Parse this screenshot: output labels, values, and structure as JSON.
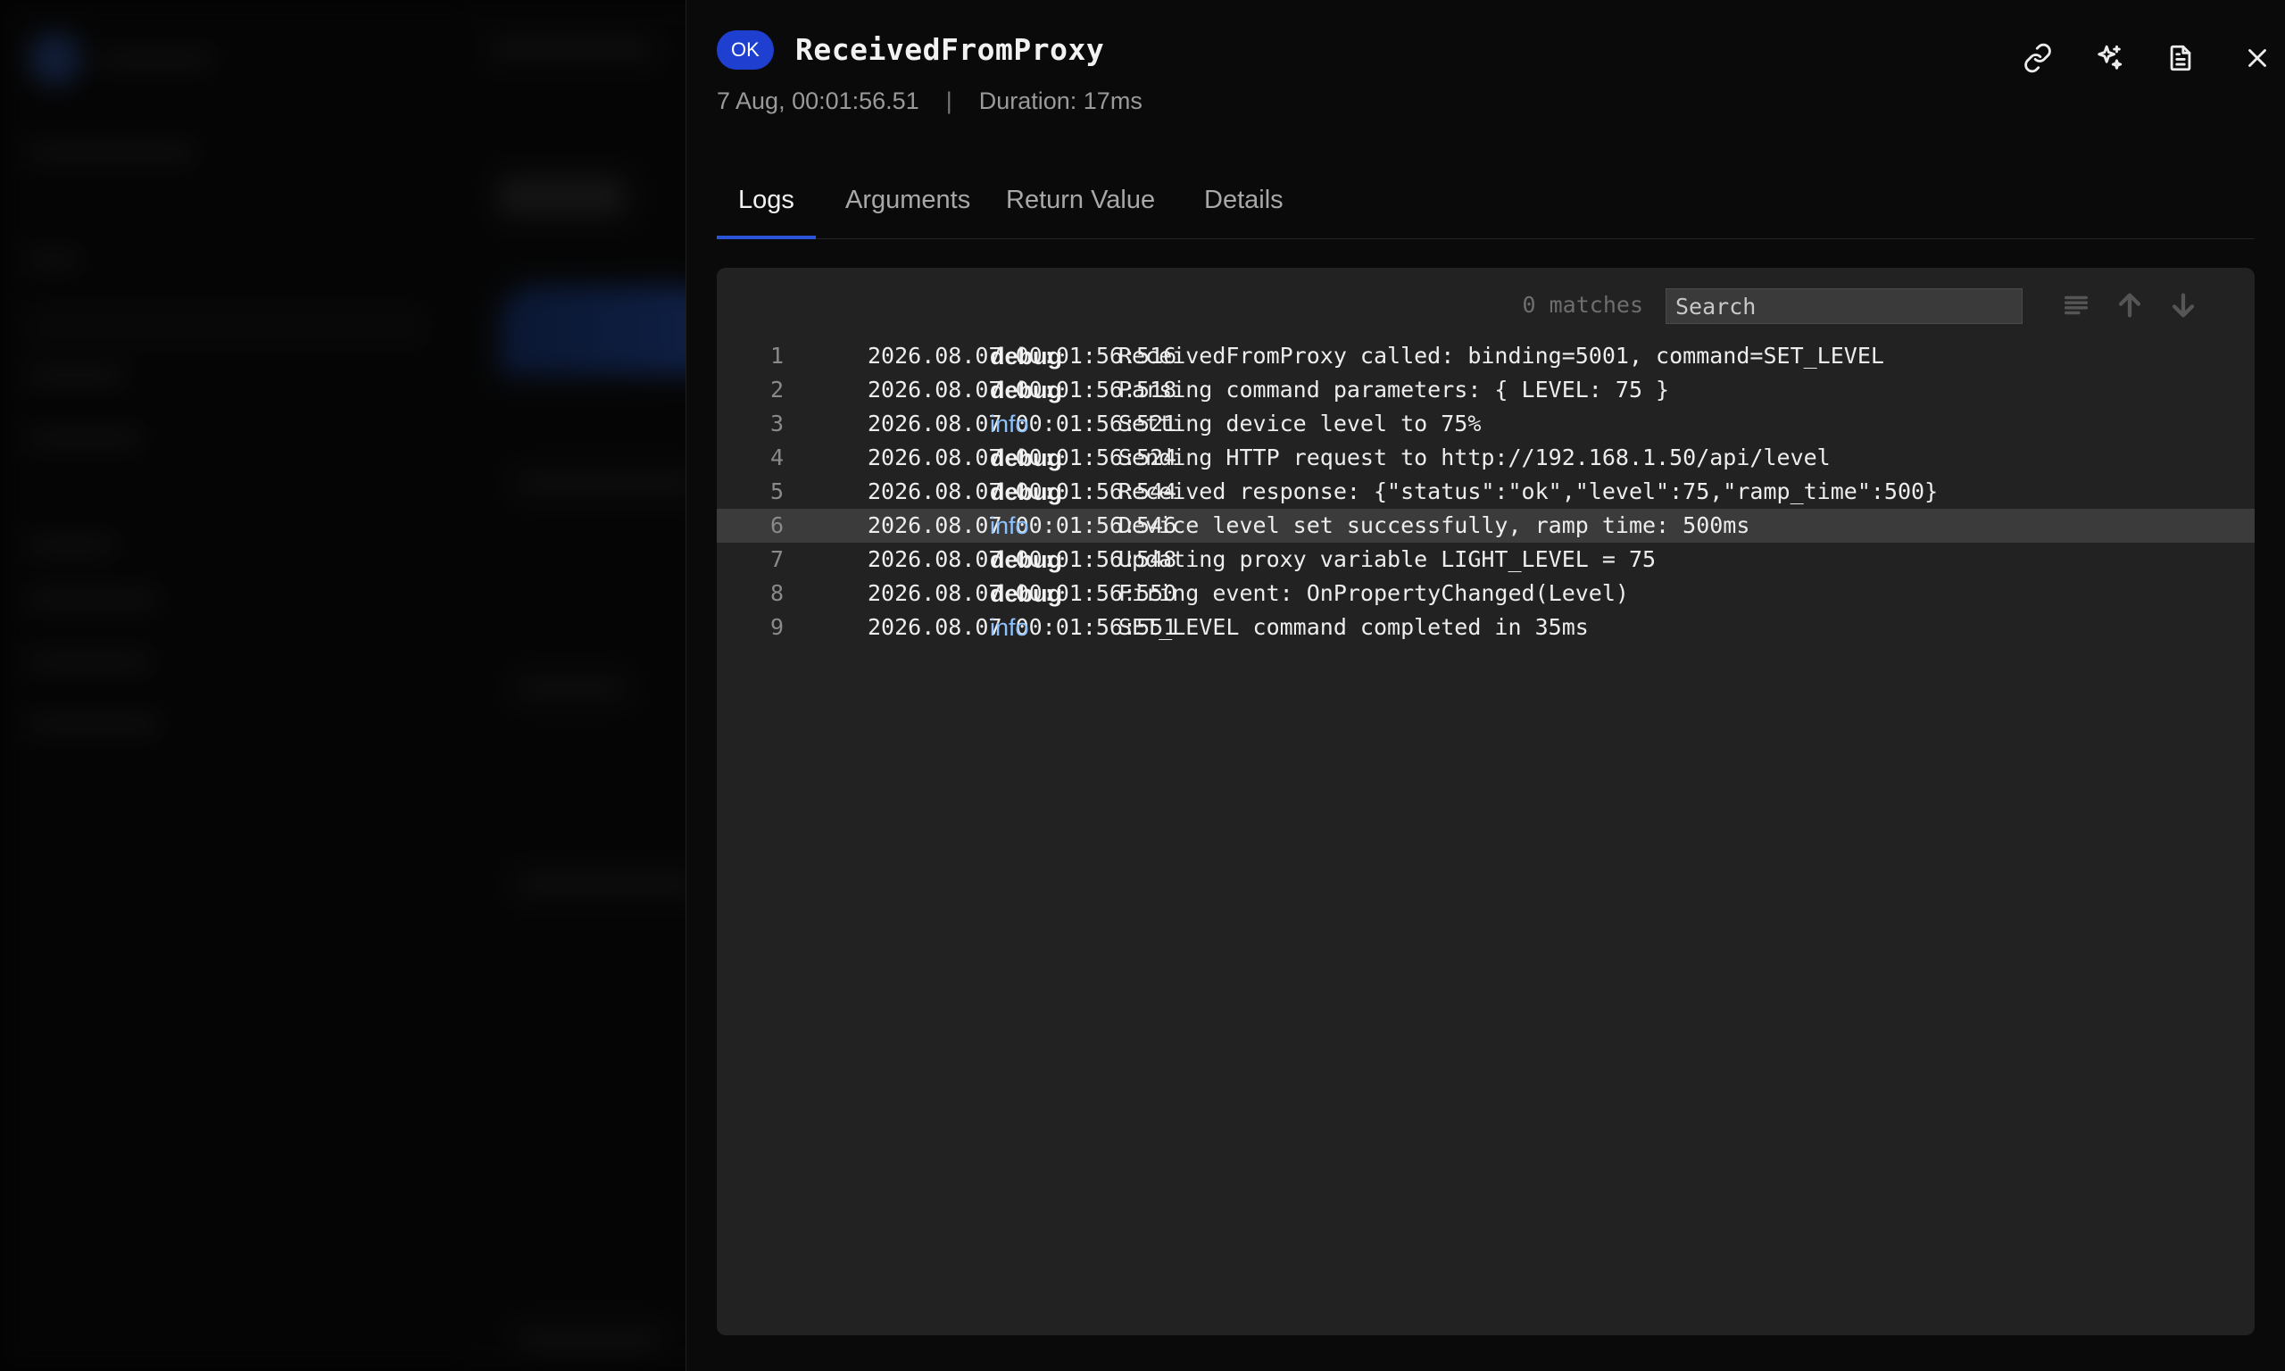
{
  "drawer": {
    "status_badge": "OK",
    "title": "ReceivedFromProxy",
    "timestamp": "7 Aug, 00:01:56.51",
    "separator": "|",
    "duration": "Duration: 17ms",
    "actions": [
      "link-icon",
      "sparkles-icon",
      "document-icon",
      "close-icon"
    ]
  },
  "tabs": [
    {
      "label": "Logs",
      "active": true
    },
    {
      "label": "Arguments",
      "active": false
    },
    {
      "label": "Return Value",
      "active": false
    },
    {
      "label": "Details",
      "active": false
    }
  ],
  "log_panel": {
    "matches": "0 matches",
    "search_placeholder": "Search",
    "search_value": "",
    "highlighted_line": 6,
    "entries": [
      {
        "line": "1",
        "timestamp": "2026.08.07 00:01:56:516",
        "level": "debug",
        "message": "ReceivedFromProxy called: binding=5001, command=SET_LEVEL"
      },
      {
        "line": "2",
        "timestamp": "2026.08.07 00:01:56:518",
        "level": "debug",
        "message": "Parsing command parameters: { LEVEL: 75 }"
      },
      {
        "line": "3",
        "timestamp": "2026.08.07 00:01:56:521",
        "level": "info",
        "message": "Setting device level to 75%"
      },
      {
        "line": "4",
        "timestamp": "2026.08.07 00:01:56:524",
        "level": "debug",
        "message": "Sending HTTP request to http://192.168.1.50/api/level"
      },
      {
        "line": "5",
        "timestamp": "2026.08.07 00:01:56:544",
        "level": "debug",
        "message": "Received response: {\"status\":\"ok\",\"level\":75,\"ramp_time\":500}"
      },
      {
        "line": "6",
        "timestamp": "2026.08.07 00:01:56:546",
        "level": "info",
        "message": "Device level set successfully, ramp time: 500ms"
      },
      {
        "line": "7",
        "timestamp": "2026.08.07 00:01:56:548",
        "level": "debug",
        "message": "Updating proxy variable LIGHT_LEVEL = 75"
      },
      {
        "line": "8",
        "timestamp": "2026.08.07 00:01:56:550",
        "level": "debug",
        "message": "Firing event: OnPropertyChanged(Level)"
      },
      {
        "line": "9",
        "timestamp": "2026.08.07 00:01:56:551",
        "level": "info",
        "message": "SET_LEVEL command completed in 35ms"
      }
    ]
  },
  "colors": {
    "badge": "#1e3fd0",
    "tab_underline": "#2b54d8",
    "info_level": "#8ec2ff",
    "panel_bg": "#222222",
    "highlight_row": "#3b3b3b"
  }
}
